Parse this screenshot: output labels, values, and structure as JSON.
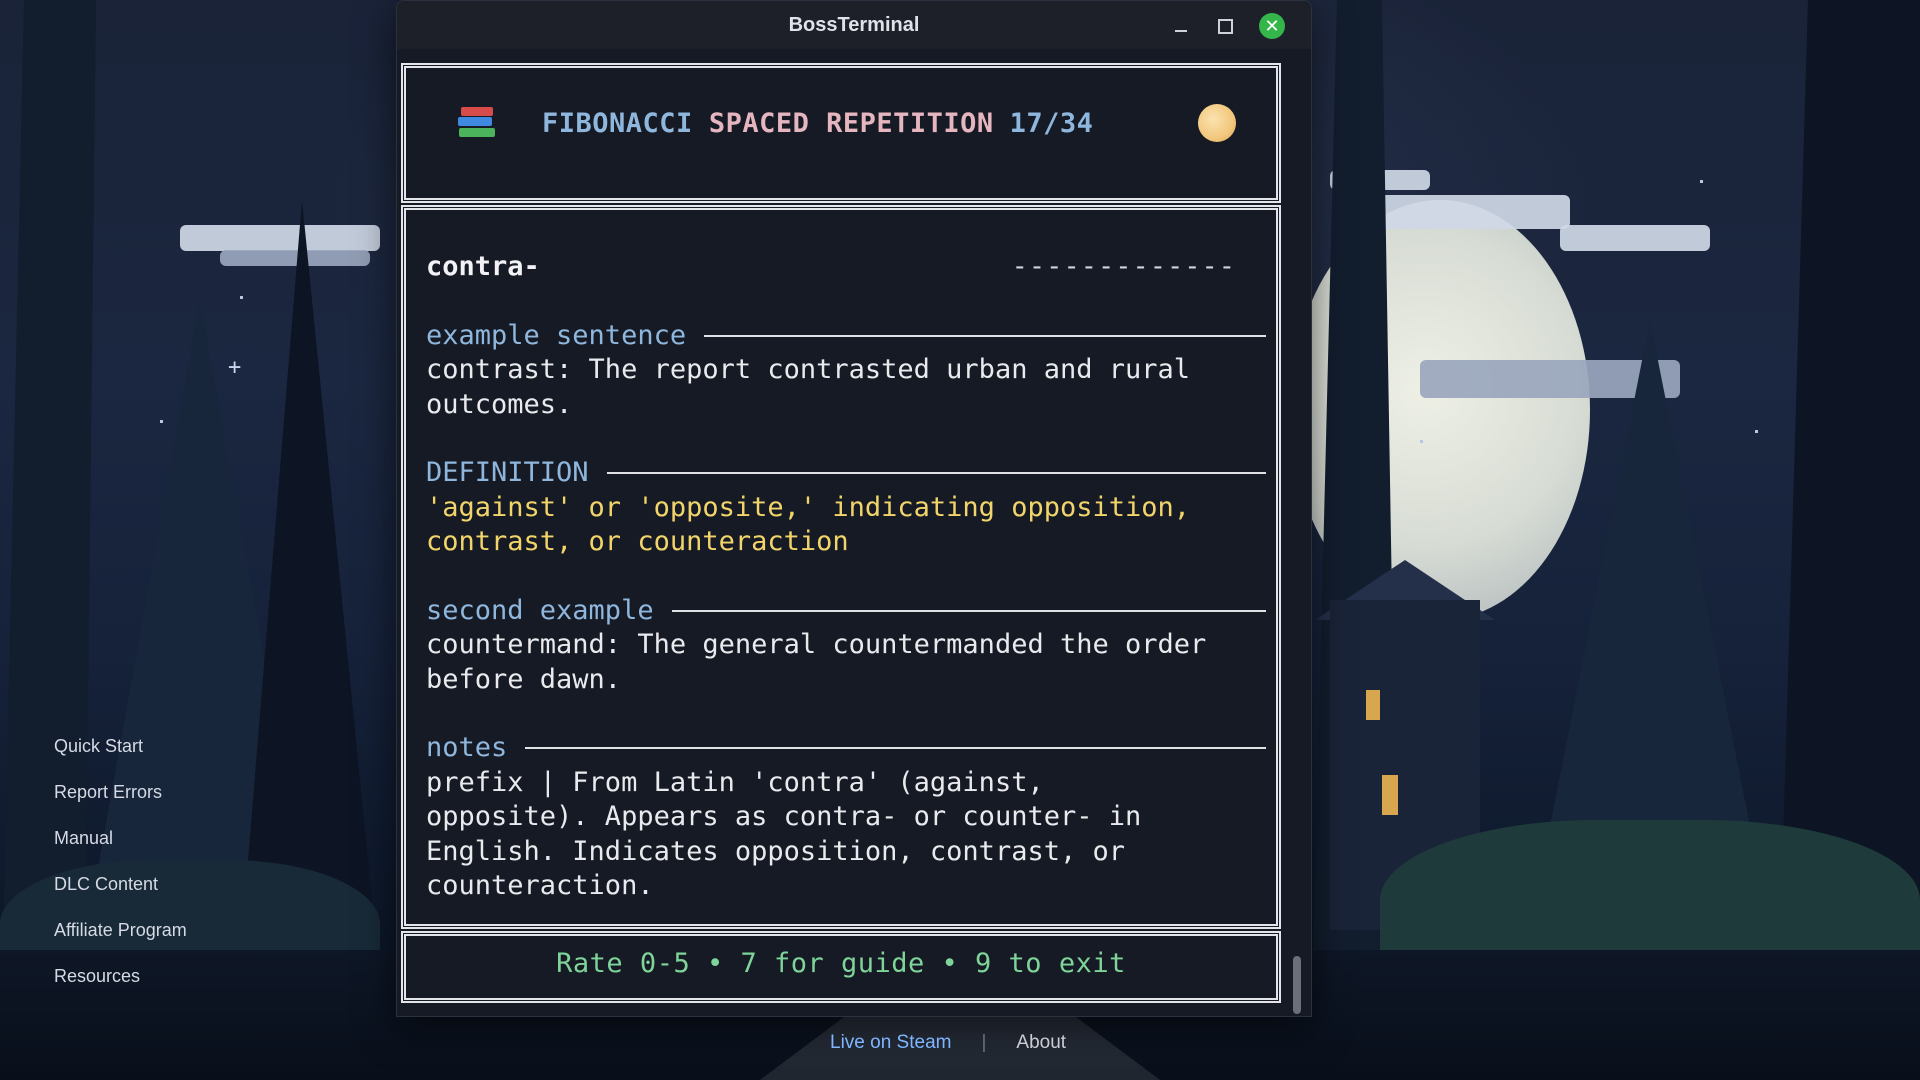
{
  "window": {
    "title": "BossTerminal"
  },
  "header": {
    "icon": "books-icon",
    "part1": "FIBONACCI",
    "part2": "SPACED REPETITION",
    "progress": "17/34",
    "status_icon": "moon-icon"
  },
  "card": {
    "term": "contra-",
    "answer_mask": "-------------",
    "sections": [
      {
        "heading": "example sentence",
        "text": "contrast: The report contrasted urban and rural\noutcomes."
      },
      {
        "heading": "DEFINITION",
        "text": "'against' or 'opposite,' indicating opposition,\ncontrast, or counteraction"
      },
      {
        "heading": "second example",
        "text": "countermand: The general countermanded the order\nbefore dawn."
      },
      {
        "heading": "notes",
        "text": "prefix | From Latin 'contra' (against,\nopposite). Appears as contra- or counter- in\nEnglish. Indicates opposition, contrast, or\ncounteraction."
      }
    ]
  },
  "footer_hint": "Rate 0-5 • 7 for guide • 9 to exit",
  "side_menu": [
    "Quick Start",
    "Report Errors",
    "Manual",
    "DLC Content",
    "Affiliate Program",
    "Resources"
  ],
  "bottom_links": {
    "steam": "Live on Steam",
    "separator": "|",
    "about": "About"
  },
  "colors": {
    "accent_blue": "#8fb7de",
    "accent_pink": "#e5b6bf",
    "definition_yellow": "#f2d56a",
    "hint_green": "#7fd49a",
    "close_green": "#35b64a",
    "steam_link": "#7fb6ff"
  }
}
